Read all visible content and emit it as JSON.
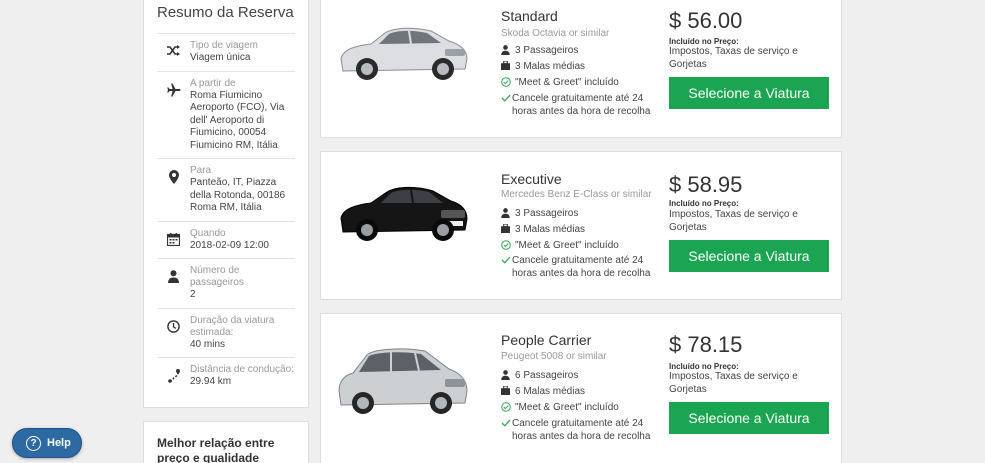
{
  "summary": {
    "title": "Resumo da Reserva",
    "rows": [
      {
        "icon": "shuffle-icon",
        "label": "Tipo de viagem",
        "value": "Viagem única"
      },
      {
        "icon": "airplane-icon",
        "label": "A partir de",
        "value": "Roma Fiumicino Aeroporto (FCO), Via dell' Aeroporto di Fiumicino, 00054 Fiumicino RM, Itália"
      },
      {
        "icon": "map-pin-icon",
        "label": "Para",
        "value": "Panteão, IT, Piazza della Rotonda, 00186 Roma RM, Itália"
      },
      {
        "icon": "calendar-icon",
        "label": "Quando",
        "value": "2018-02-09 12:00"
      },
      {
        "icon": "person-icon",
        "label": "Número de passageiros",
        "value": "2"
      },
      {
        "icon": "clock-icon",
        "label": "Duração da viatura estimada:",
        "value": "40 mins"
      },
      {
        "icon": "route-icon",
        "label": "Distância de condução:",
        "value": "29.94 km"
      }
    ]
  },
  "best_value": {
    "title": "Melhor relação entre preço e qualidade"
  },
  "cars": [
    {
      "name": "Standard",
      "model": "Skoda Octavia or similar",
      "passengers": "3 Passageiros",
      "luggage": "3 Malas médias",
      "meet": "\"Meet & Greet\" incluído",
      "cancel": "Cancele gratuitamente até 24 horas antes da hora de recolha",
      "price": "$ 56.00",
      "included_label": "Incluído no Preço:",
      "included_text": "Impostos, Taxas de serviço e Gorjetas",
      "button": "Selecione a Viatura",
      "color": "#d8dadd"
    },
    {
      "name": "Executive",
      "model": "Mercedes Benz E-Class or similar",
      "passengers": "3 Passageiros",
      "luggage": "3 Malas médias",
      "meet": "\"Meet & Greet\" incluído",
      "cancel": "Cancele gratuitamente até 24 horas antes da hora de recolha",
      "price": "$ 58.95",
      "included_label": "Incluído no Preço:",
      "included_text": "Impostos, Taxas de serviço e Gorjetas",
      "button": "Selecione a Viatura",
      "color": "#111111"
    },
    {
      "name": "People Carrier",
      "model": "Peugeot 5008 or similar",
      "passengers": "6 Passageiros",
      "luggage": "6 Malas médias",
      "meet": "\"Meet & Greet\" incluído",
      "cancel": "Cancele gratuitamente até 24 horas antes da hora de recolha",
      "price": "$ 78.15",
      "included_label": "Incluído no Preço:",
      "included_text": "Impostos, Taxas de serviço e Gorjetas",
      "button": "Selecione a Viatura",
      "color": "#c9cbce"
    }
  ],
  "help": {
    "label": "Help"
  },
  "colors": {
    "accent": "#1ba552",
    "help": "#2d6aa3"
  }
}
